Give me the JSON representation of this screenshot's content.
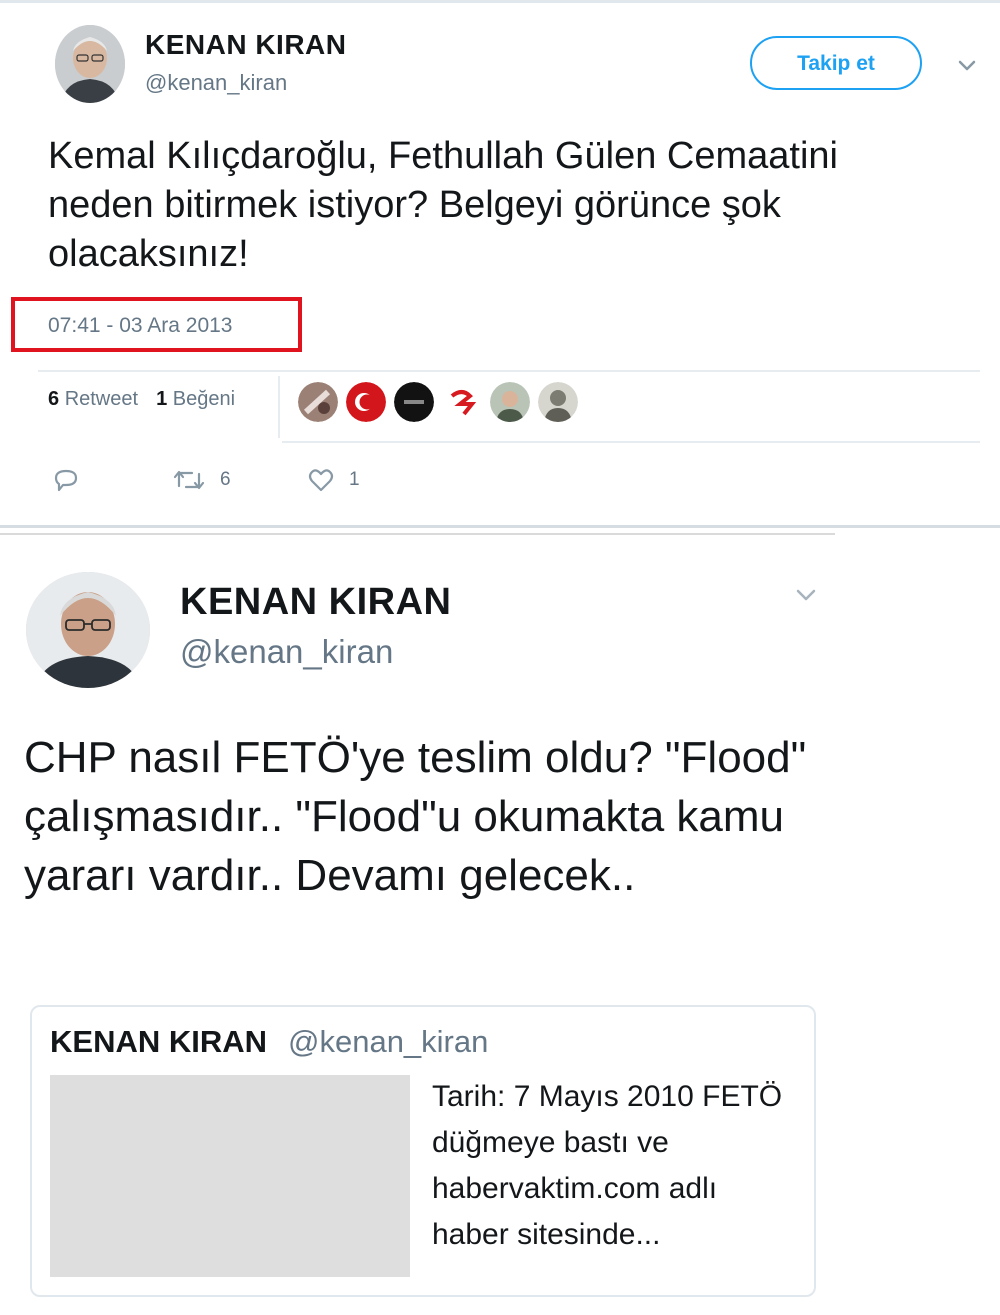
{
  "tweet1": {
    "author": {
      "name": "KENAN KIRAN",
      "handle": "@kenan_kiran"
    },
    "follow_label": "Takip et",
    "text": "Kemal Kılıçdaroğlu, Fethullah Gülen Cemaatini neden bitirmek istiyor? Belgeyi görünce şok olacaksınız!",
    "timestamp": "07:41 - 03 Ara 2013",
    "stats": {
      "retweet_count": "6",
      "retweet_label": "Retweet",
      "like_count": "1",
      "like_label": "Beğeni"
    },
    "actions": {
      "retweet_count": "6",
      "like_count": "1"
    },
    "likers": [
      "liker-avatar-1",
      "liker-avatar-2",
      "liker-avatar-3",
      "liker-avatar-4",
      "liker-avatar-5",
      "liker-avatar-6"
    ],
    "colors": {
      "accent": "#1da1f2",
      "highlight": "#e0141e",
      "muted": "#657786"
    }
  },
  "tweet2": {
    "author": {
      "name": "KENAN KIRAN",
      "handle": "@kenan_kiran"
    },
    "text": "CHP nasıl FETÖ'ye teslim oldu? \"Flood\" çalışmasıdır.. \"Flood\"u okumakta kamu yararı vardır.. Devamı gelecek..",
    "quoted": {
      "name": "KENAN KIRAN",
      "handle": "@kenan_kiran",
      "text": "Tarih: 7 Mayıs 2010 FETÖ düğmeye bastı ve habervaktim.com adlı haber sitesinde..."
    }
  }
}
